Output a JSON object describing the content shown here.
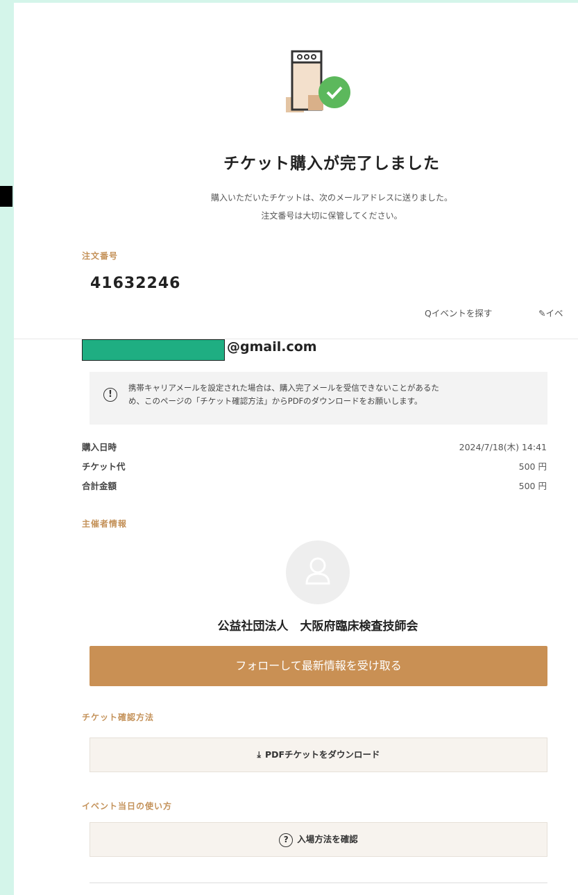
{
  "completion": {
    "title": "チケット購入が完了しました",
    "message_line1": "購入いただいたチケットは、次のメールアドレスに送りました。",
    "message_line2": "注文番号は大切に保管してください。"
  },
  "order": {
    "label": "注文番号",
    "number": "41632246",
    "email_domain": "@gmail.com"
  },
  "nav": {
    "search": "イベントを探す",
    "event": "イベ"
  },
  "notice": {
    "line1": "携帯キャリアメールを設定された場合は、購入完了メールを受信できないことがあるた",
    "line2": "め、このページの「チケット確認方法」からPDFのダウンロードをお願いします。"
  },
  "details": {
    "purchase_date_label": "購入日時",
    "purchase_date": "2024/7/18(木) 14:41",
    "ticket_price_label": "チケット代",
    "ticket_price": "500 円",
    "total_label": "合計金額",
    "total": "500 円"
  },
  "organizer": {
    "section_label": "主催者情報",
    "name": "公益社団法人　大阪府臨床検査技師会",
    "follow_button": "フォローして最新情報を受け取る"
  },
  "ticket_check": {
    "section_label": "チケット確認方法",
    "pdf_button": "PDFチケットをダウンロード"
  },
  "event_day": {
    "section_label": "イベント当日の使い方",
    "entry_button": "入場方法を確認"
  },
  "colors": {
    "accent": "#c99054",
    "label": "#c4925a",
    "success": "#5cb85c",
    "background": "#d4f5ea"
  }
}
